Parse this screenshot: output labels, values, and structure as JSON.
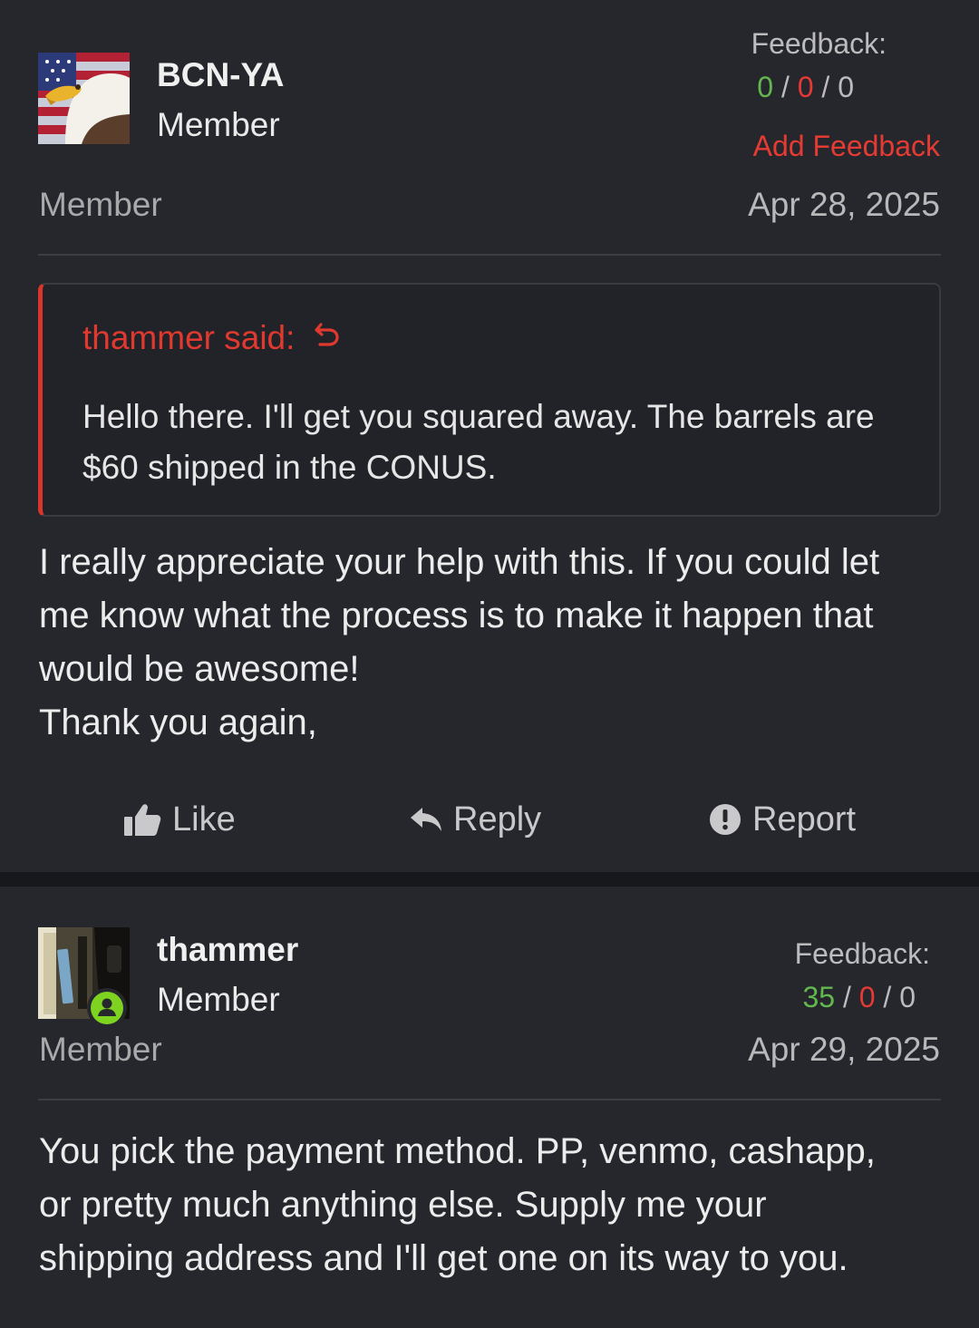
{
  "post1": {
    "username": "BCN-YA",
    "user_title": "Member",
    "role": "Member",
    "feedback": {
      "label": "Feedback:",
      "positive": "0",
      "negative": "0",
      "neutral": "0",
      "sep": "/"
    },
    "add_feedback": "Add Feedback",
    "date": "Apr 28, 2025",
    "quote": {
      "author": "thammer said:",
      "text": "Hello there. I'll get you squared away. The barrels are $60 shipped in the CONUS."
    },
    "message_lines": [
      "I really appreciate your help with this. If you could let",
      "me know what the process is to make it happen that",
      "would be awesome!",
      "Thank you again,"
    ],
    "actions": {
      "like": "Like",
      "reply": "Reply",
      "report": "Report"
    }
  },
  "post2": {
    "username": "thammer",
    "user_title": "Member",
    "role": "Member",
    "feedback": {
      "label": "Feedback:",
      "positive": "35",
      "negative": "0",
      "neutral": "0",
      "sep": "/"
    },
    "date": "Apr 29, 2025",
    "message_lines": [
      "You pick the payment method. PP, venmo, cashapp,",
      "or pretty much anything else. Supply me your",
      "shipping address and I'll get one on its way to you."
    ]
  },
  "colors": {
    "background": "#26272c",
    "accent_red": "#e63b33",
    "positive_green": "#62b84e",
    "online_green": "#7ed321"
  }
}
